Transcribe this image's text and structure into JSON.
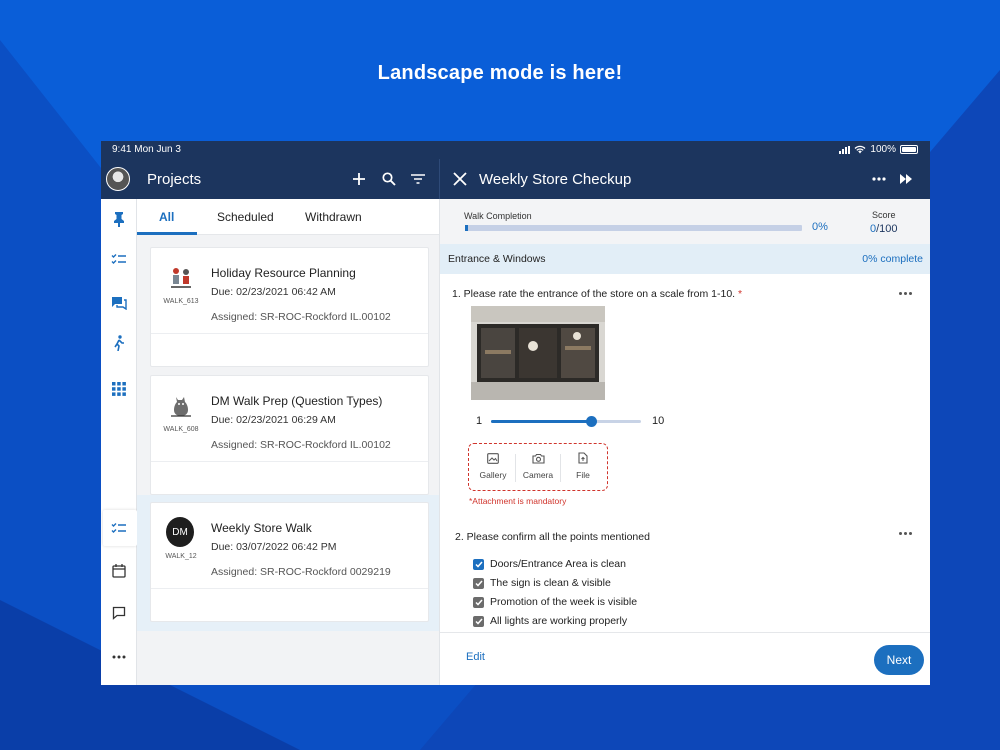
{
  "promo": {
    "headline": "Landscape mode is here!"
  },
  "status_bar": {
    "time": "9:41  Mon Jun 3",
    "battery": "100%"
  },
  "left_header": {
    "title": "Projects"
  },
  "tabs": [
    {
      "label": "All",
      "active": true
    },
    {
      "label": "Scheduled",
      "active": false
    },
    {
      "label": "Withdrawn",
      "active": false
    }
  ],
  "projects": [
    {
      "title": "Holiday Resource Planning",
      "due": "Due: 02/23/2021 06:42 AM",
      "assigned": "Assigned: SR-ROC-Rockford IL.00102",
      "code": "WALK_613",
      "thumb_icon": "people-illustration-icon"
    },
    {
      "title": "DM Walk Prep (Question Types)",
      "due": "Due: 02/23/2021 06:29 AM",
      "assigned": "Assigned: SR-ROC-Rockford IL.00102",
      "code": "WALK_608",
      "thumb_icon": "cat-illustration-icon"
    },
    {
      "title": "Weekly Store Walk",
      "due": "Due: 03/07/2022 06:42 PM",
      "assigned": "Assigned: SR-ROC-Rockford 0029219",
      "code": "WALK_12",
      "badge": "DM",
      "selected": true
    }
  ],
  "right_header": {
    "title": "Weekly Store Checkup"
  },
  "completion": {
    "label": "Walk Completion",
    "percent_text": "0%",
    "fraction": 0.01
  },
  "score": {
    "label": "Score",
    "value": "0",
    "total": "/100"
  },
  "section": {
    "name": "Entrance & Windows",
    "percent_text": "0% complete"
  },
  "question1": {
    "text": "1.   Please rate the entrance of the store on a scale from 1-10.",
    "required_mark": "*",
    "slider": {
      "min": "1",
      "max": "10",
      "value": 7
    },
    "attachments": [
      {
        "label": "Gallery",
        "icon": "gallery-icon"
      },
      {
        "label": "Camera",
        "icon": "camera-icon"
      },
      {
        "label": "File",
        "icon": "file-icon"
      }
    ],
    "attachment_error": "*Attachment is mandatory"
  },
  "question2": {
    "text": "2.   Please confirm all the points mentioned",
    "items": [
      {
        "label": "Doors/Entrance Area is clean",
        "checked": true,
        "color": "#1c6fbf"
      },
      {
        "label": "The sign is clean & visible",
        "checked": true,
        "color": "#6b6b6b"
      },
      {
        "label": "Promotion of the week is visible",
        "checked": true,
        "color": "#6b6b6b"
      },
      {
        "label": "All lights are working properly",
        "checked": true,
        "color": "#6b6b6b"
      }
    ]
  },
  "footer": {
    "edit_label": "Edit",
    "next_label": "Next"
  },
  "colors": {
    "navy": "#1c355e",
    "accent": "#1c6fbf",
    "error": "#d0342c",
    "background": "#0a5ed8"
  }
}
